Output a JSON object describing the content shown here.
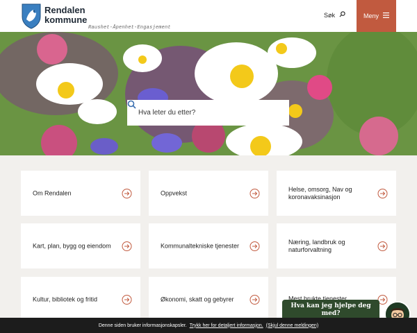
{
  "header": {
    "logo_line1": "Rendalen",
    "logo_line2": "kommune",
    "tagline": "Raushet-Åpenhet-Engasjement",
    "search_label": "Søk",
    "menu_label": "Meny"
  },
  "hero": {
    "search_placeholder": "Hva leter du etter?"
  },
  "cards": [
    {
      "label": "Om Rendalen"
    },
    {
      "label": "Oppvekst"
    },
    {
      "label": "Helse, omsorg, Nav og koronavaksinasjon"
    },
    {
      "label": "Kart, plan, bygg og eiendom"
    },
    {
      "label": "Kommunaltekniske tjenester"
    },
    {
      "label": "Næring, landbruk og naturforvaltning"
    },
    {
      "label": "Kultur, bibliotek og fritid"
    },
    {
      "label": "Økonomi, skatt og gebyrer"
    },
    {
      "label": "Mest brukte tjenester"
    }
  ],
  "chat": {
    "label": "Hva kan jeg hjelpe deg med?"
  },
  "cookie_bar": {
    "text": "Denne siden bruker informasjonskapsler.",
    "details_link": "Trykk her for detaljert informasjon.",
    "hide_link": "(Skjul denne meldingen)"
  },
  "colors": {
    "accent": "#c15a3f",
    "chat": "#2f4a2c",
    "cookie_bar": "#1c1c1c"
  }
}
